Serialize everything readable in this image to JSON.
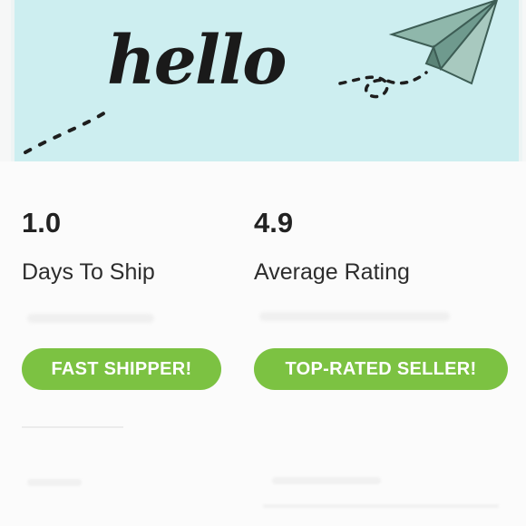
{
  "banner": {
    "greeting": "hello"
  },
  "stats": [
    {
      "value": "1.0",
      "label": "Days To Ship"
    },
    {
      "value": "4.9",
      "label": "Average Rating"
    }
  ],
  "badges": [
    {
      "label": "FAST SHIPPER!"
    },
    {
      "label": "TOP-RATED SELLER!"
    }
  ],
  "colors": {
    "badge": "#7cc242",
    "banner_bg": "#cdeef0",
    "plane": "#7fa69b"
  },
  "icons": {
    "plane": "paper-plane-icon"
  }
}
